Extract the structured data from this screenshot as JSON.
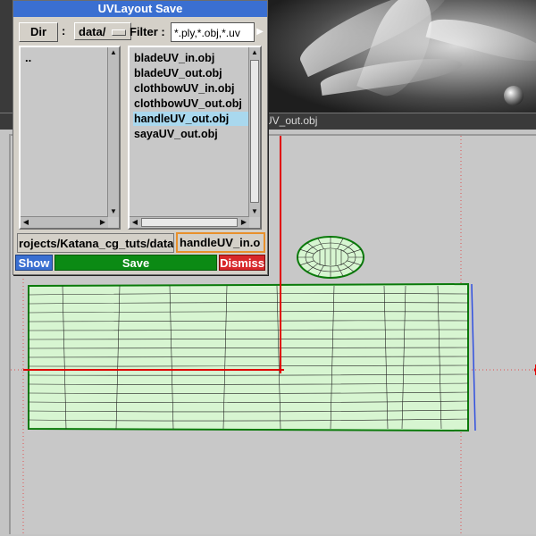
{
  "dialog": {
    "title": "UVLayout Save",
    "dir_button": "Dir",
    "colon": ":",
    "dir_select": "data/",
    "filter_label": "Filter :",
    "filter_value": "*.ply,*.obj,*.uv",
    "dir_items": [
      ".."
    ],
    "files": [
      {
        "name": "bladeUV_in.obj",
        "selected": false
      },
      {
        "name": "bladeUV_out.obj",
        "selected": false
      },
      {
        "name": "clothbowUV_in.obj",
        "selected": false
      },
      {
        "name": "clothbowUV_out.obj",
        "selected": false
      },
      {
        "name": "handleUV_out.obj",
        "selected": true
      },
      {
        "name": "sayaUV_out.obj",
        "selected": false
      }
    ],
    "path_value": "rojects/Katana_cg_tuts/data/",
    "filename_value": "handleUV_in.o",
    "show_label": "Show",
    "save_label": "Save",
    "dismiss_label": "Dismiss"
  },
  "viewport": {
    "title": "UV_out.obj"
  },
  "colors": {
    "title_blue": "#3a6fd1",
    "save_green": "#0b8a14",
    "dismiss_red": "#d8282a",
    "selection": "#a9d8ee",
    "focus_orange": "#e8902b",
    "uv_fill": "#d7f5d1",
    "uv_edge": "#0a7a0a",
    "axis_red": "#e00000"
  }
}
